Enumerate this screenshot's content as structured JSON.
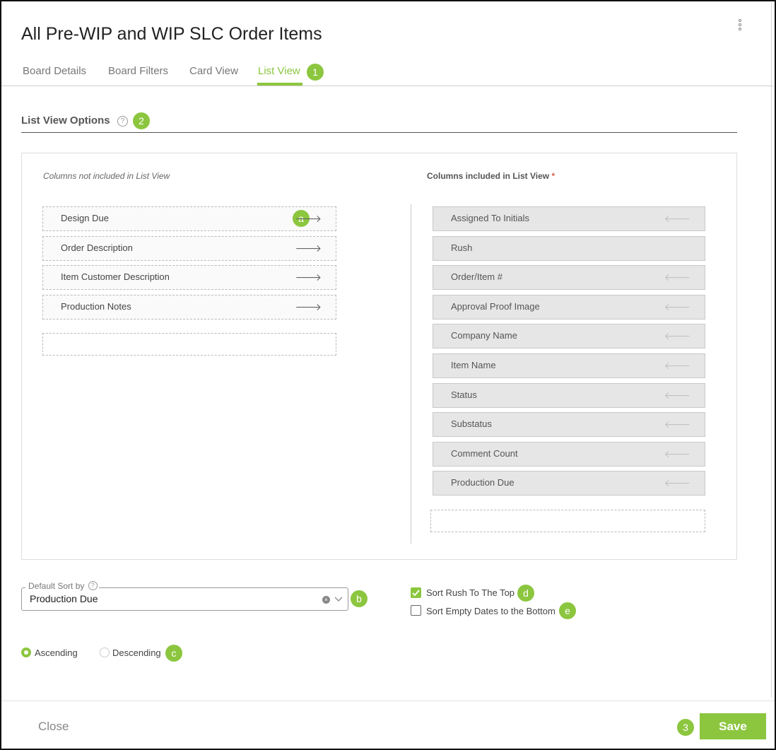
{
  "dialog": {
    "title": "All Pre-WIP and WIP SLC Order Items",
    "menu_icon": "kebab-vertical-icon"
  },
  "tabs": [
    {
      "label": "Board Details"
    },
    {
      "label": "Board Filters"
    },
    {
      "label": "Card View"
    },
    {
      "label": "List View",
      "active": true
    }
  ],
  "callouts": {
    "tab": "1",
    "section": "2",
    "save": "3",
    "move_column": "a",
    "sort": "b",
    "order": "c",
    "rush": "d",
    "empty_dates": "e"
  },
  "section": {
    "title": "List View Options",
    "help_icon": "question-circle-icon",
    "help_glyph": "?"
  },
  "columns": {
    "excluded_heading": "Columns not included in List View",
    "included_heading": "Columns included in List View",
    "required_mark": "*",
    "excluded": [
      "Design Due",
      "Order Description",
      "Item Customer Description",
      "Production Notes"
    ],
    "included": [
      "Assigned To Initials",
      "Rush",
      "Order/Item #",
      "Approval Proof Image",
      "Company Name",
      "Item Name",
      "Status",
      "Substatus",
      "Comment Count",
      "Production Due"
    ],
    "move_right_glyph": "🡒",
    "move_left_glyph": "🡐"
  },
  "sort": {
    "label": "Default Sort by",
    "value": "Production Due",
    "clear_glyph": "×"
  },
  "order": {
    "ascending": "Ascending",
    "descending": "Descending",
    "selected": "Ascending"
  },
  "options": {
    "rush_top": {
      "label": "Sort Rush To The Top",
      "checked": true
    },
    "empty_dates_bottom": {
      "label": "Sort Empty Dates to the Bottom",
      "checked": false
    }
  },
  "footer": {
    "close_label": "Close",
    "save_label": "Save"
  },
  "colors": {
    "accent": "#8cc63f",
    "required": "#e05b4c"
  }
}
